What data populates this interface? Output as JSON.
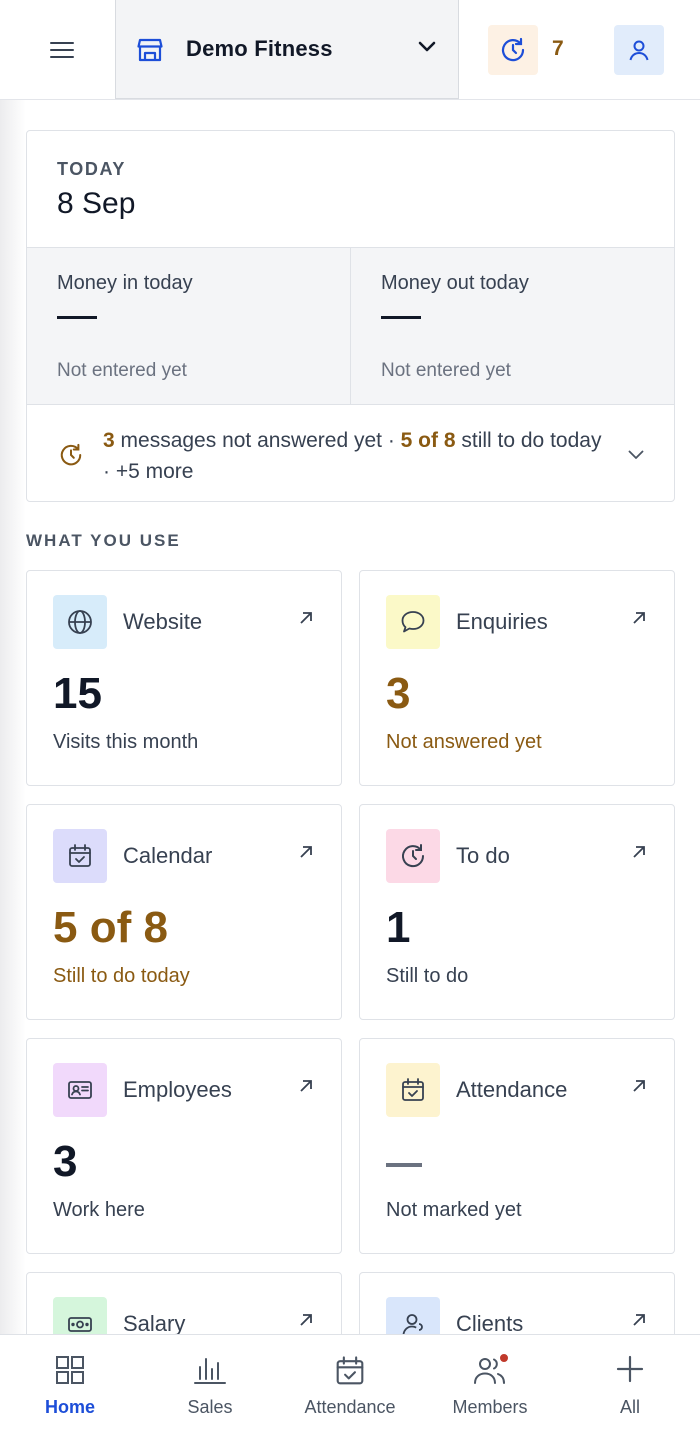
{
  "header": {
    "org_name": "Demo Fitness",
    "pending_count": "7",
    "icons": {
      "menu": "hamburger-icon",
      "store": "store-icon",
      "chevron": "chevron-down-icon",
      "pending": "history-clock-icon",
      "user": "user-icon"
    }
  },
  "today": {
    "label": "TODAY",
    "date": "8 Sep",
    "money_in": {
      "title": "Money in today",
      "value": "—",
      "sub": "Not entered yet"
    },
    "money_out": {
      "title": "Money out today",
      "value": "—",
      "sub": "Not entered yet"
    },
    "summary": {
      "messages_count": "3",
      "messages_text": " messages not answered yet · ",
      "todo_count": "5 of 8",
      "todo_text": " still to do today · +5 more"
    }
  },
  "section": {
    "title": "WHAT YOU USE"
  },
  "tiles": [
    {
      "title": "Website",
      "value": "15",
      "sub": "Visits this month",
      "icon": "globe-icon",
      "color": "#d7ecfa"
    },
    {
      "title": "Enquiries",
      "value": "3",
      "sub": "Not answered yet",
      "icon": "chat-bubble-icon",
      "color": "#fbf9c8"
    },
    {
      "title": "Calendar",
      "value": "5 of 8",
      "sub": "Still to do today",
      "icon": "calendar-check-icon",
      "color": "#dcdcfb"
    },
    {
      "title": "To do",
      "value": "1",
      "sub": "Still to do",
      "icon": "history-clock-icon",
      "color": "#fcd9e6"
    },
    {
      "title": "Employees",
      "value": "3",
      "sub": "Work here",
      "icon": "id-card-icon",
      "color": "#f1d9fb"
    },
    {
      "title": "Attendance",
      "value": "",
      "sub": "Not marked yet",
      "icon": "calendar-check-icon",
      "color": "#fdf3cf"
    },
    {
      "title": "Salary",
      "value": "",
      "sub": "",
      "icon": "cash-icon",
      "color": "#d5f6dc"
    },
    {
      "title": "Clients",
      "value": "",
      "sub": "",
      "icon": "user-icon",
      "color": "#d9e6fb"
    }
  ],
  "nav": [
    {
      "label": "Home",
      "icon": "grid-icon",
      "active": true
    },
    {
      "label": "Sales",
      "icon": "bar-chart-icon"
    },
    {
      "label": "Attendance",
      "icon": "calendar-check-icon"
    },
    {
      "label": "Members",
      "icon": "users-icon",
      "badge": true
    },
    {
      "label": "All",
      "icon": "plus-icon"
    }
  ],
  "colors": {
    "accent": "#8a5a12",
    "primary": "#1d4ed8",
    "badge": "#c0392b"
  }
}
